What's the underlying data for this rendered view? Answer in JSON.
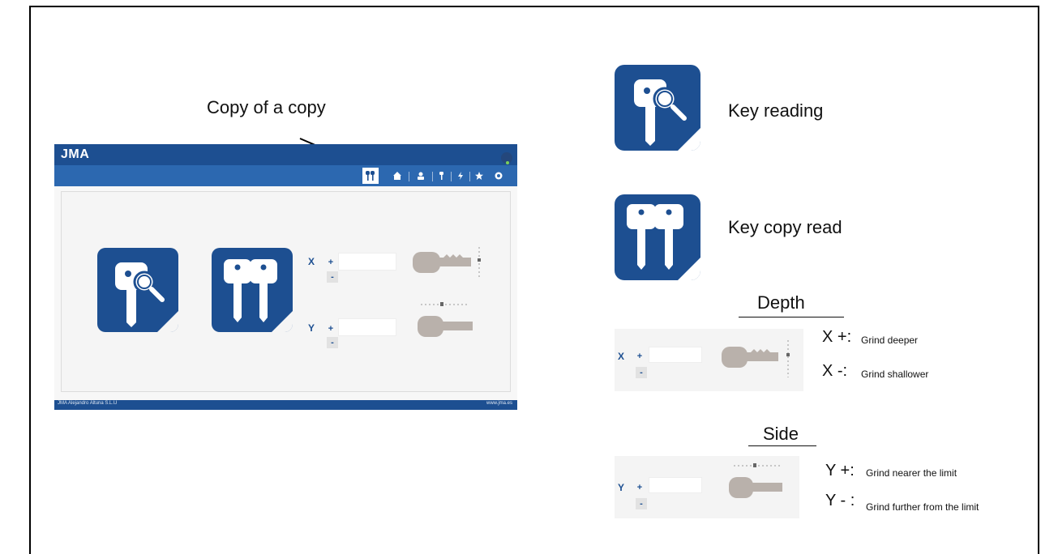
{
  "callout": {
    "label": "Copy of a copy"
  },
  "app": {
    "logo": "JMA",
    "footer_left": "JMA Alejandro Altuna S.L.U",
    "footer_right": "www.jma.es",
    "axis_x": "X",
    "axis_y": "Y",
    "plus": "+",
    "minus": "-",
    "nav_icons": [
      "key-copy-icon",
      "home-icon",
      "user-icon",
      "key-icon",
      "flash-icon",
      "star-icon",
      "settings-icon"
    ],
    "accent_color": "#1d4f91"
  },
  "legend": [
    {
      "icon": "key-reading-icon",
      "label": "Key reading"
    },
    {
      "icon": "key-copy-read-icon",
      "label": "Key copy read"
    }
  ],
  "depth": {
    "title": "Depth",
    "axis": "X",
    "plus": "+",
    "minus": "-",
    "items": [
      {
        "key": "X +:",
        "text": "Grind deeper"
      },
      {
        "key": "X -:",
        "text": "Grind shallower"
      }
    ]
  },
  "side": {
    "title": "Side",
    "axis": "Y",
    "plus": "+",
    "minus": "-",
    "items": [
      {
        "key": "Y +:",
        "text": "Grind nearer the limit"
      },
      {
        "key": "Y - :",
        "text": "Grind further from the limit"
      }
    ]
  }
}
